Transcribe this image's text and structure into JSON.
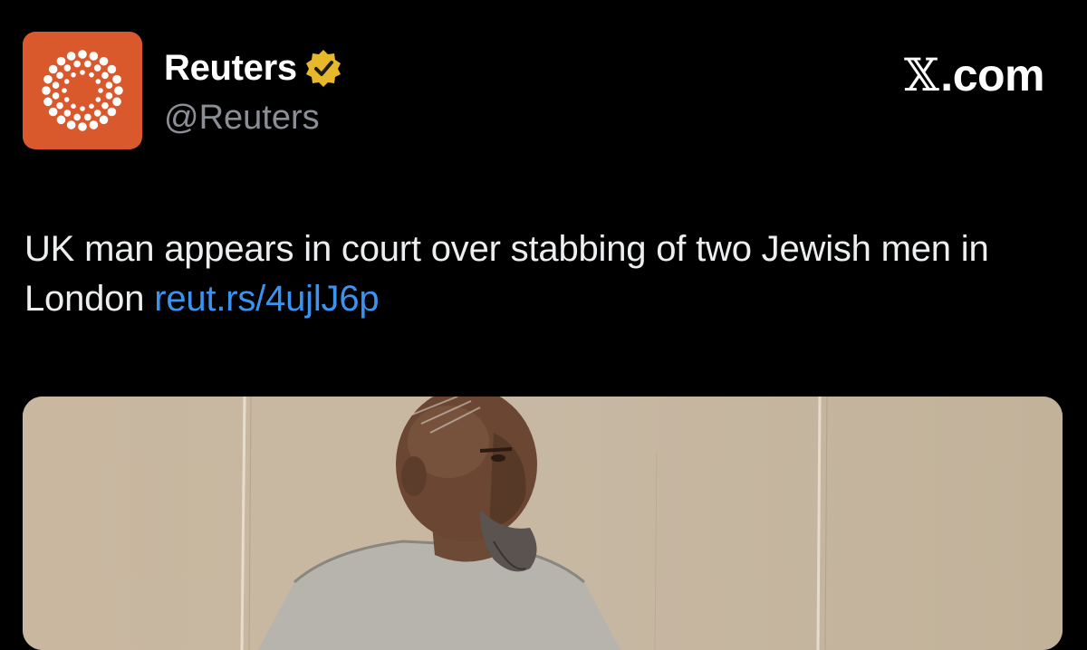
{
  "account": {
    "name": "Reuters",
    "handle": "@Reuters",
    "verified_icon": "verified-badge-icon",
    "avatar_icon": "reuters-logo-icon"
  },
  "brand": {
    "x_mark": "𝕏",
    "domain": ".com"
  },
  "tweet": {
    "text": "UK man appears in court over stabbing of two Jewish men in London",
    "link": "reut.rs/4ujlJ6p"
  },
  "colors": {
    "background": "#000000",
    "avatar_bg": "#d9592c",
    "verified_gold": "#e8b82c",
    "link_blue": "#3b93f0",
    "handle_gray": "#8b8f95"
  },
  "media": {
    "type": "courtroom-sketch-image"
  }
}
